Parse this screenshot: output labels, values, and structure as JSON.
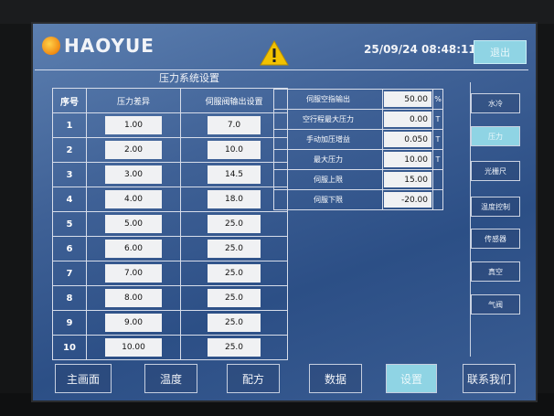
{
  "brand": {
    "name": "HAOYUE"
  },
  "status": {
    "datetime": "25/09/24 08:48:11"
  },
  "header": {
    "exit_label": "退出"
  },
  "page": {
    "title": "压力系统设置"
  },
  "left_table": {
    "headers": [
      "序号",
      "压力差异",
      "伺服阀输出设置"
    ],
    "rows": [
      {
        "idx": "1",
        "diff": "1.00",
        "servo": "7.0"
      },
      {
        "idx": "2",
        "diff": "2.00",
        "servo": "10.0"
      },
      {
        "idx": "3",
        "diff": "3.00",
        "servo": "14.5"
      },
      {
        "idx": "4",
        "diff": "4.00",
        "servo": "18.0"
      },
      {
        "idx": "5",
        "diff": "5.00",
        "servo": "25.0"
      },
      {
        "idx": "6",
        "diff": "6.00",
        "servo": "25.0"
      },
      {
        "idx": "7",
        "diff": "7.00",
        "servo": "25.0"
      },
      {
        "idx": "8",
        "diff": "8.00",
        "servo": "25.0"
      },
      {
        "idx": "9",
        "diff": "9.00",
        "servo": "25.0"
      },
      {
        "idx": "10",
        "diff": "10.00",
        "servo": "25.0"
      }
    ]
  },
  "right_table": {
    "rows": [
      {
        "label": "伺服空指输出",
        "value": "50.00",
        "unit": "%"
      },
      {
        "label": "空行程最大压力",
        "value": "0.00",
        "unit": "T"
      },
      {
        "label": "手动加压增益",
        "value": "0.050",
        "unit": "T"
      },
      {
        "label": "最大压力",
        "value": "10.00",
        "unit": "T"
      },
      {
        "label": "伺服上限",
        "value": "15.00",
        "unit": ""
      },
      {
        "label": "伺服下限",
        "value": "-20.00",
        "unit": ""
      }
    ]
  },
  "sidebar": {
    "items": [
      {
        "label": "水冷",
        "active": false
      },
      {
        "label": "压力",
        "active": true
      },
      {
        "label": "光栅尺",
        "active": false
      },
      {
        "label": "温度控制",
        "active": false
      },
      {
        "label": "传感器",
        "active": false
      },
      {
        "label": "真空",
        "active": false
      },
      {
        "label": "气阀",
        "active": false
      }
    ]
  },
  "bottom_nav": {
    "items": [
      {
        "label": "主画面",
        "active": false
      },
      {
        "label": "温度",
        "active": false
      },
      {
        "label": "配方",
        "active": false
      },
      {
        "label": "数据",
        "active": false
      },
      {
        "label": "设置",
        "active": true
      },
      {
        "label": "联系我们",
        "active": false
      }
    ]
  },
  "colors": {
    "accent": "#8fd4e4",
    "warning": "#f2c200"
  },
  "icons": {
    "warning": "warning-triangle-icon",
    "logo": "haoyue-logo-icon"
  }
}
